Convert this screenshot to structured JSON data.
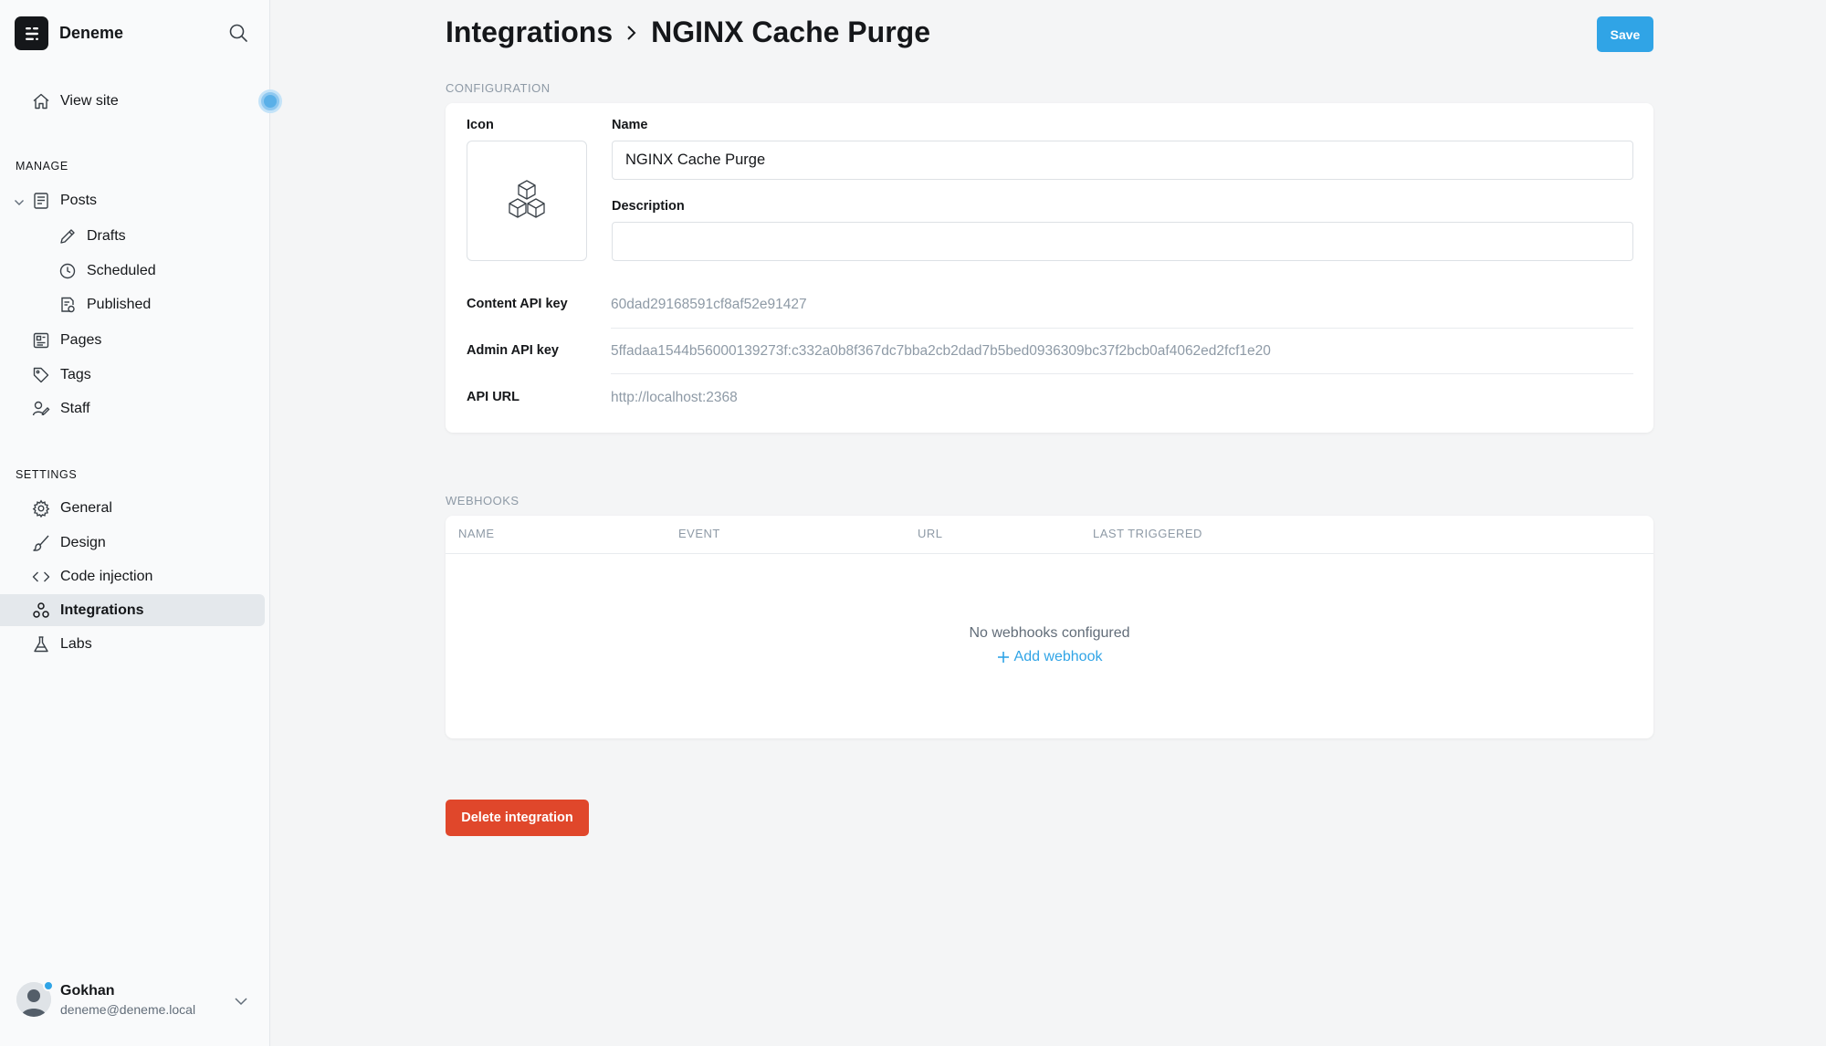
{
  "brand": {
    "name": "Deneme",
    "logo_icon": "ghost-logo-icon"
  },
  "sidebar": {
    "view_site": "View site",
    "manage_label": "MANAGE",
    "posts": "Posts",
    "drafts": "Drafts",
    "scheduled": "Scheduled",
    "published": "Published",
    "pages": "Pages",
    "tags": "Tags",
    "staff": "Staff",
    "settings_label": "SETTINGS",
    "general": "General",
    "design": "Design",
    "code_injection": "Code injection",
    "integrations": "Integrations",
    "labs": "Labs"
  },
  "user": {
    "name": "Gokhan",
    "email": "deneme@deneme.local"
  },
  "header": {
    "breadcrumb_parent": "Integrations",
    "title": "NGINX Cache Purge",
    "save_label": "Save"
  },
  "configuration": {
    "section_label": "CONFIGURATION",
    "icon_label": "Icon",
    "name_label": "Name",
    "name_value": "NGINX Cache Purge",
    "description_label": "Description",
    "description_value": "",
    "content_api_key_label": "Content API key",
    "content_api_key": "60dad29168591cf8af52e91427",
    "admin_api_key_label": "Admin API key",
    "admin_api_key": "5ffadaa1544b56000139273f:c332a0b8f367dc7bba2cb2dad7b5bed0936309bc37f2bcb0af4062ed2fcf1e20",
    "api_url_label": "API URL",
    "api_url": "http://localhost:2368"
  },
  "webhooks": {
    "section_label": "WEBHOOKS",
    "columns": [
      "NAME",
      "EVENT",
      "URL",
      "LAST TRIGGERED"
    ],
    "empty_message": "No webhooks configured",
    "add_label": "Add webhook"
  },
  "delete_label": "Delete integration",
  "colors": {
    "accent": "#30a4e6",
    "danger": "#e0472b",
    "text": "#15171a",
    "muted": "#8e9aa6"
  }
}
